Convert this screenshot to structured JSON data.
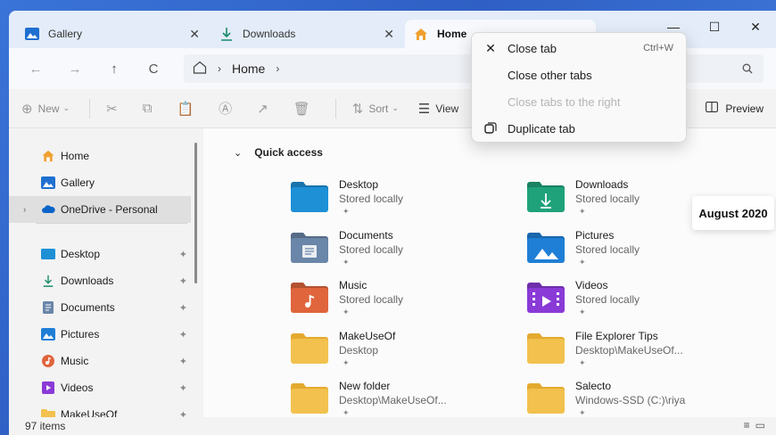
{
  "tabs": [
    {
      "label": "Gallery",
      "icon": "gallery-icon",
      "active": false
    },
    {
      "label": "Downloads",
      "icon": "download-icon",
      "active": false
    },
    {
      "label": "Home",
      "icon": "home-icon",
      "active": true
    }
  ],
  "tab_close_glyph": "✕",
  "window_controls": {
    "minimize": "—",
    "maximize": "☐",
    "close": "✕"
  },
  "nav": {
    "back": "←",
    "forward": "→",
    "up": "↑",
    "refresh": "C",
    "breadcrumb": [
      "Home"
    ],
    "breadcrumb_sep": "›",
    "search_icon": "search-icon"
  },
  "toolbar": {
    "new_label": "New",
    "sort_label": "Sort",
    "view_label": "View",
    "preview_label": "Preview"
  },
  "sidebar": {
    "top_items": [
      {
        "label": "Home",
        "icon": "home-icon"
      },
      {
        "label": "Gallery",
        "icon": "gallery-icon"
      },
      {
        "label": "OneDrive - Personal",
        "icon": "onedrive-icon",
        "selected": true
      }
    ],
    "pinned_items": [
      {
        "label": "Desktop",
        "icon": "desktop-folder-icon"
      },
      {
        "label": "Downloads",
        "icon": "download-icon"
      },
      {
        "label": "Documents",
        "icon": "documents-icon"
      },
      {
        "label": "Pictures",
        "icon": "pictures-icon"
      },
      {
        "label": "Music",
        "icon": "music-icon"
      },
      {
        "label": "Videos",
        "icon": "videos-icon"
      },
      {
        "label": "MakeUseOf",
        "icon": "folder-icon"
      }
    ],
    "pin_glyph": "✦"
  },
  "main": {
    "section_title": "Quick access",
    "items": [
      {
        "name": "Desktop",
        "location": "Stored locally",
        "icon": "desktop-folder-icon",
        "color": "#1e90d6"
      },
      {
        "name": "Downloads",
        "location": "Stored locally",
        "icon": "downloads-folder-icon",
        "color": "#1fa27a"
      },
      {
        "name": "Documents",
        "location": "Stored locally",
        "icon": "documents-folder-icon",
        "color": "#6a86a8"
      },
      {
        "name": "Pictures",
        "location": "Stored locally",
        "icon": "pictures-folder-icon",
        "color": "#1f7fd6"
      },
      {
        "name": "Music",
        "location": "Stored locally",
        "icon": "music-folder-icon",
        "color": "#e0653c"
      },
      {
        "name": "Videos",
        "location": "Stored locally",
        "icon": "videos-folder-icon",
        "color": "#8a3ad6"
      },
      {
        "name": "MakeUseOf",
        "location": "Desktop",
        "icon": "folder-icon",
        "color": "#f2c14e"
      },
      {
        "name": "File Explorer Tips",
        "location": "Desktop\\MakeUseOf...",
        "icon": "folder-icon",
        "color": "#f2c14e"
      },
      {
        "name": "New folder",
        "location": "Desktop\\MakeUseOf...",
        "icon": "folder-icon",
        "color": "#f2c14e"
      },
      {
        "name": "Salecto",
        "location": "Windows-SSD (C:)\\riya",
        "icon": "folder-icon",
        "color": "#f2c14e"
      }
    ]
  },
  "status": {
    "item_count": "97 items"
  },
  "context_menu": {
    "items": [
      {
        "label": "Close tab",
        "shortcut": "Ctrl+W",
        "icon": "close-icon",
        "disabled": false
      },
      {
        "label": "Close other tabs",
        "shortcut": "",
        "icon": "",
        "disabled": false
      },
      {
        "label": "Close tabs to the right",
        "shortcut": "",
        "icon": "",
        "disabled": true
      },
      {
        "label": "Duplicate tab",
        "shortcut": "",
        "icon": "duplicate-icon",
        "disabled": false
      }
    ]
  },
  "date_badge": "August 2020"
}
